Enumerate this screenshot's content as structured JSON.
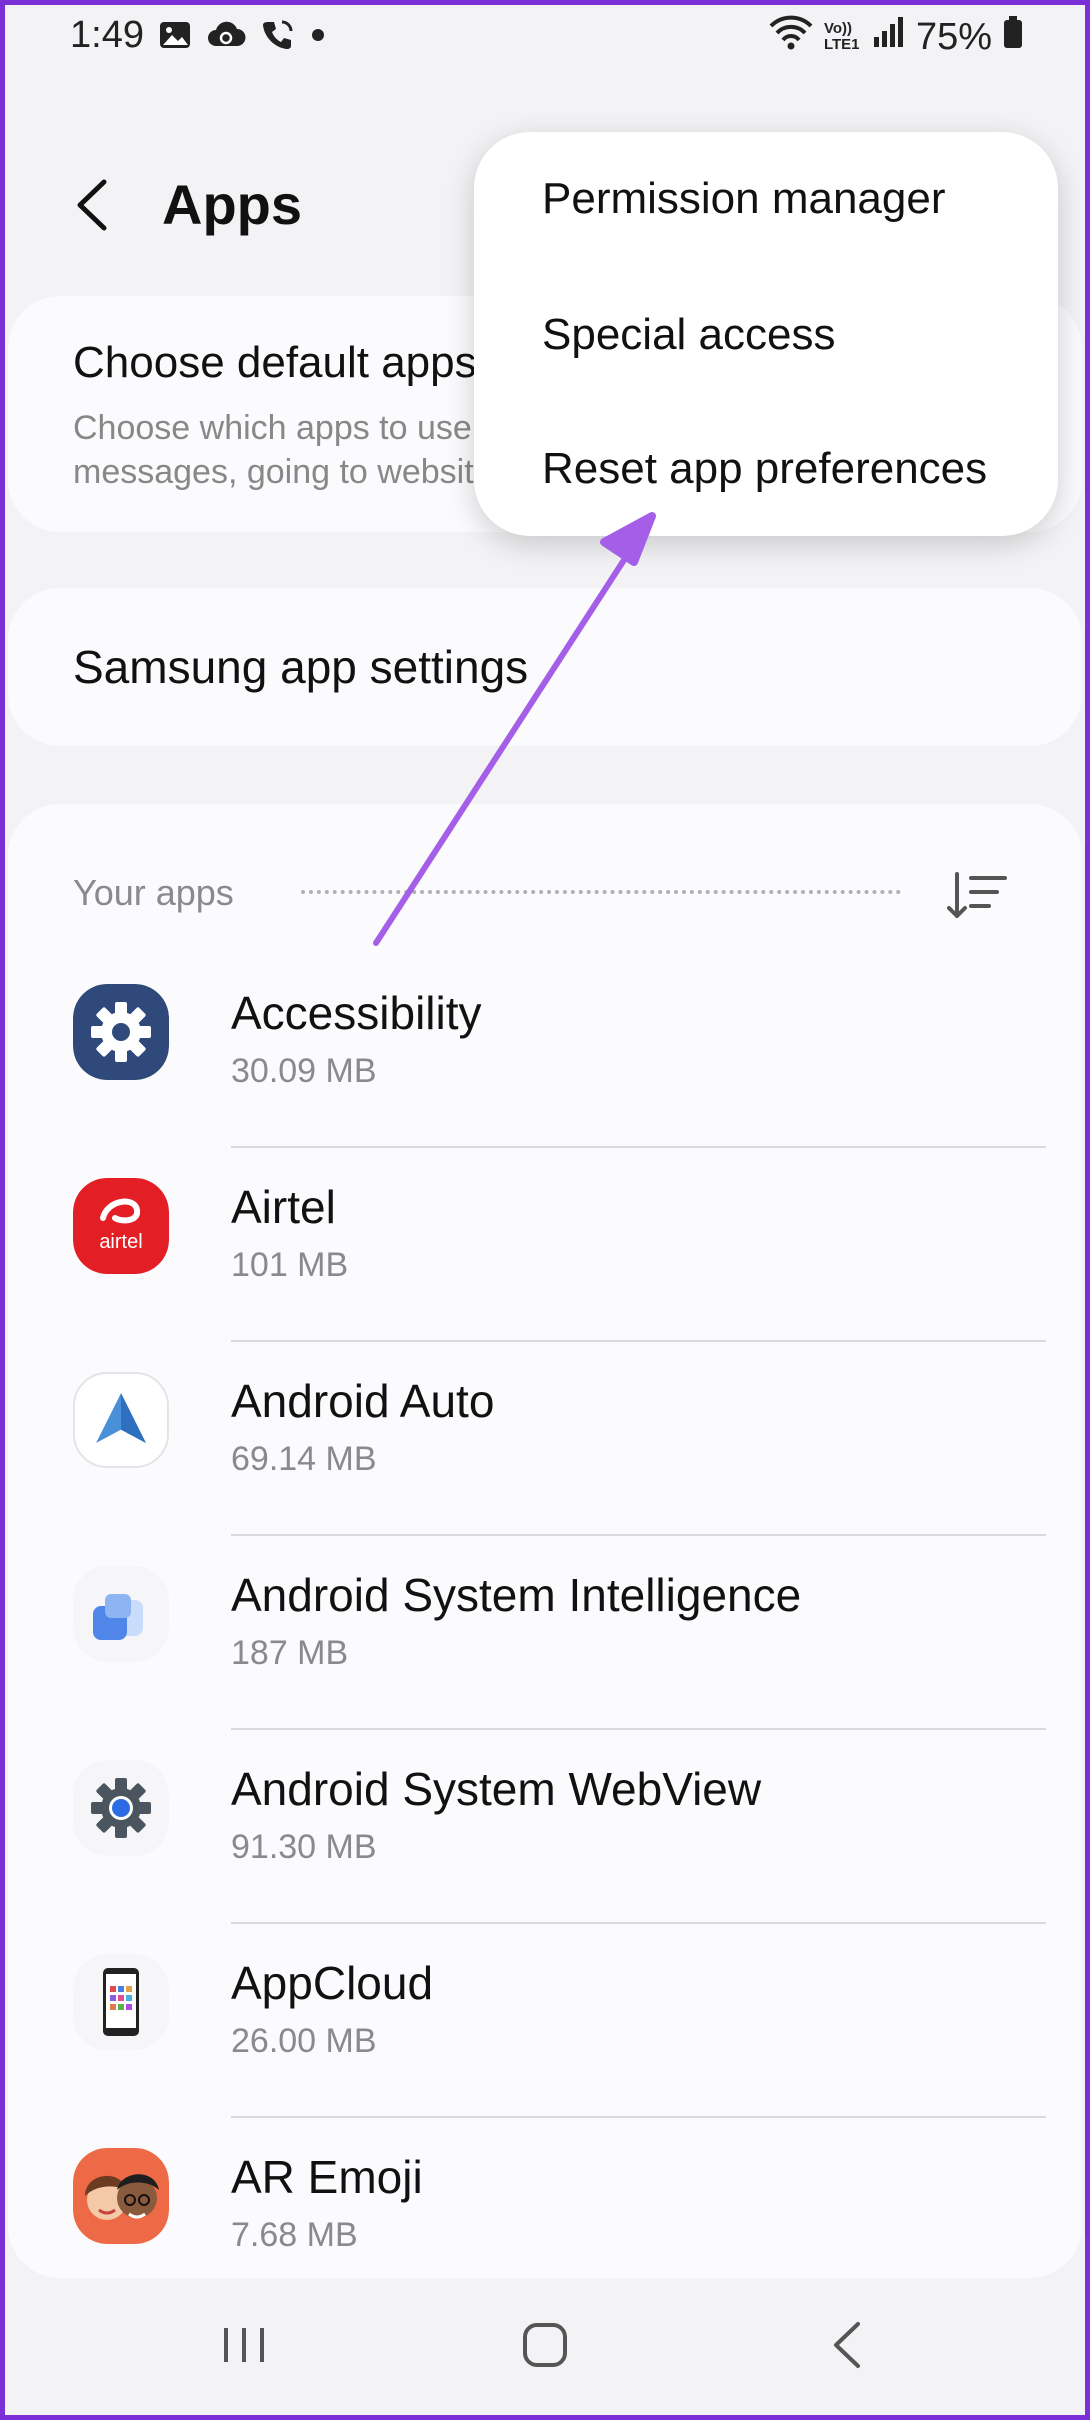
{
  "status_bar": {
    "time": "1:49",
    "battery": "75%",
    "network_label": "Vo)) LTE1",
    "left_icons": [
      "gallery-icon",
      "cloud-sync-icon",
      "wifi-call-icon",
      "dot-icon"
    ],
    "right_icons": [
      "wifi-icon",
      "volte-icon",
      "signal-icon",
      "battery-icon"
    ]
  },
  "header": {
    "title": "Apps",
    "back_icon": "back-arrow-icon"
  },
  "default_apps": {
    "title": "Choose default apps",
    "description_line1": "Choose which apps to use for calls and",
    "description_line2": "messages, going to websites, and more"
  },
  "samsung_settings": {
    "title": "Samsung app settings"
  },
  "your_apps": {
    "title": "Your apps",
    "sort_icon": "sort-icon",
    "apps": [
      {
        "name": "Accessibility",
        "size": "30.09 MB",
        "icon": "accessibility-gear-icon",
        "color": "#2f4a7a"
      },
      {
        "name": "Airtel",
        "size": "101 MB",
        "icon": "airtel-icon",
        "color": "#e31e24"
      },
      {
        "name": "Android Auto",
        "size": "69.14 MB",
        "icon": "android-auto-icon",
        "color": "#4a90d9"
      },
      {
        "name": "Android System Intelligence",
        "size": "187 MB",
        "icon": "system-intelligence-icon",
        "color": "#4f86e8"
      },
      {
        "name": "Android System WebView",
        "size": "91.30 MB",
        "icon": "webview-gear-icon",
        "color": "#4a5560"
      },
      {
        "name": "AppCloud",
        "size": "26.00 MB",
        "icon": "appcloud-icon",
        "color": "#222222"
      },
      {
        "name": "AR Emoji",
        "size": "7.68 MB",
        "icon": "ar-emoji-icon",
        "color": "#ee6a46"
      }
    ]
  },
  "popup_menu": {
    "items": [
      {
        "label": "Permission manager"
      },
      {
        "label": "Special access"
      },
      {
        "label": "Reset app preferences"
      }
    ]
  },
  "annotation": {
    "arrow_color": "#a45ee8"
  },
  "nav_bar": {
    "icons": [
      "recents-icon",
      "home-icon",
      "back-icon"
    ]
  }
}
